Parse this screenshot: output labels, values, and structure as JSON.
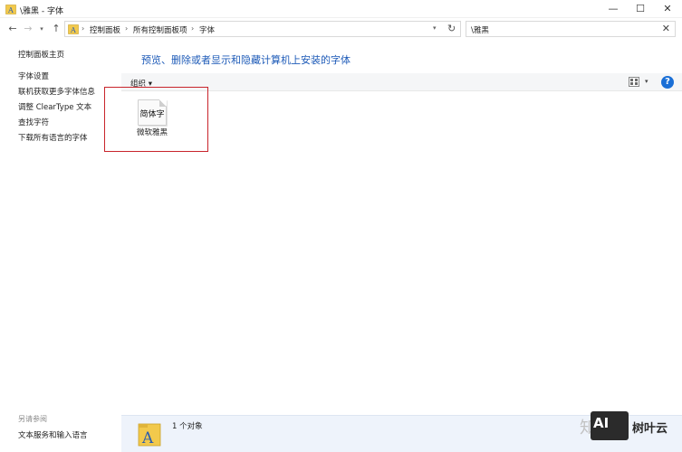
{
  "window": {
    "title": "\\雅黑 - 字体",
    "minimize_glyph": "—",
    "maximize_glyph": "☐",
    "close_glyph": "✕"
  },
  "nav": {
    "back_glyph": "←",
    "forward_glyph": "→",
    "history_glyph": "▾",
    "up_glyph": "↑",
    "dropdown_glyph": "▾",
    "refresh_glyph": "↻",
    "breadcrumbs": [
      "控制面板",
      "所有控制面板项",
      "字体"
    ],
    "separator": "›"
  },
  "search": {
    "value": "\\雅黑",
    "clear_glyph": "✕"
  },
  "sidebar": {
    "home_link": "控制面板主页",
    "links": [
      "字体设置",
      "联机获取更多字体信息",
      "调整 ClearType 文本",
      "查找字符",
      "下载所有语言的字体"
    ],
    "see_also_label": "另请参阅",
    "see_also_links": [
      "文本服务和输入语言"
    ]
  },
  "main": {
    "heading": "预览、删除或者显示和隐藏计算机上安装的字体"
  },
  "toolbar": {
    "organize_label": "组织",
    "organize_arrow": "▾",
    "view_dropdown": "▾",
    "help_glyph": "?"
  },
  "font_item": {
    "sample": "简体字",
    "name": "微软雅黑"
  },
  "status": {
    "count_text": "1 个对象"
  },
  "watermark": {
    "ghost_text": "知",
    "box_text": "AI",
    "brand_text": "树叶云"
  },
  "colors": {
    "accent_blue": "#1e5bb8",
    "help_blue": "#1a6fd6",
    "highlight_red": "#c8242b",
    "status_bg": "#eef3fb"
  }
}
